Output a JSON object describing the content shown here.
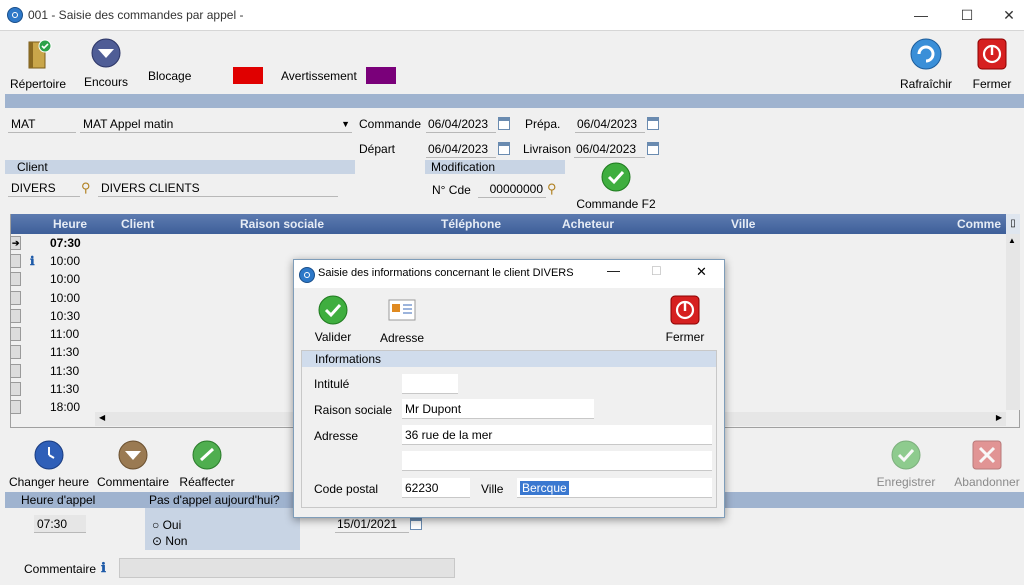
{
  "window": {
    "title": "001 - Saisie des commandes par appel -",
    "min": "—",
    "max": "☐",
    "close": "✕"
  },
  "toolbar": {
    "repertoire": "Répertoire",
    "encours": "Encours",
    "blocage": "Blocage",
    "avertissement": "Avertissement",
    "rafraichir": "Rafraîchir",
    "fermer": "Fermer",
    "colors": {
      "blocage": "#e00000",
      "avertissement": "#7a007a"
    }
  },
  "header": {
    "code": "MAT",
    "tournee": "MAT  Appel matin",
    "commande_label": "Commande",
    "commande_date": "06/04/2023",
    "prepa_label": "Prépa.",
    "prepa_date": "06/04/2023",
    "depart_label": "Départ",
    "depart_date": "06/04/2023",
    "livraison_label": "Livraison",
    "livraison_date": "06/04/2023",
    "client_label": "Client",
    "client_code": "DIVERS",
    "client_name": "DIVERS CLIENTS",
    "modification_label": "Modification",
    "ncde_label": "N° Cde",
    "ncde_value": "00000000",
    "commande_f2": "Commande F2"
  },
  "grid": {
    "columns": [
      "Heure",
      "Client",
      "Raison sociale",
      "Téléphone",
      "Acheteur",
      "Ville",
      "Comme"
    ],
    "rows": [
      "07:30",
      "10:00",
      "10:00",
      "10:00",
      "10:30",
      "11:00",
      "11:30",
      "11:30",
      "11:30",
      "18:00"
    ]
  },
  "actions": {
    "changer_heure": "Changer heure",
    "commentaire": "Commentaire",
    "reaffecter": "Réaffecter",
    "enregistrer": "Enregistrer",
    "abandonner": "Abandonner"
  },
  "bottom": {
    "heure_appel_label": "Heure d'appel",
    "heure_appel": "07:30",
    "pas_appel_label": "Pas d'appel aujourd'hui?",
    "oui": "Oui",
    "non": "Non",
    "date": "15/01/2021",
    "commentaire_label": "Commentaire"
  },
  "dialog": {
    "title": "Saisie des informations concernant le client DIVERS",
    "valider": "Valider",
    "adresse_btn": "Adresse",
    "fermer": "Fermer",
    "section": "Informations",
    "intitule_label": "Intitulé",
    "intitule": "",
    "raison_label": "Raison sociale",
    "raison": "Mr Dupont",
    "adresse_label": "Adresse",
    "adresse1": "36 rue de la mer",
    "adresse2": "",
    "cp_label": "Code postal",
    "cp": "62230",
    "ville_label": "Ville",
    "ville": "Bercque"
  }
}
